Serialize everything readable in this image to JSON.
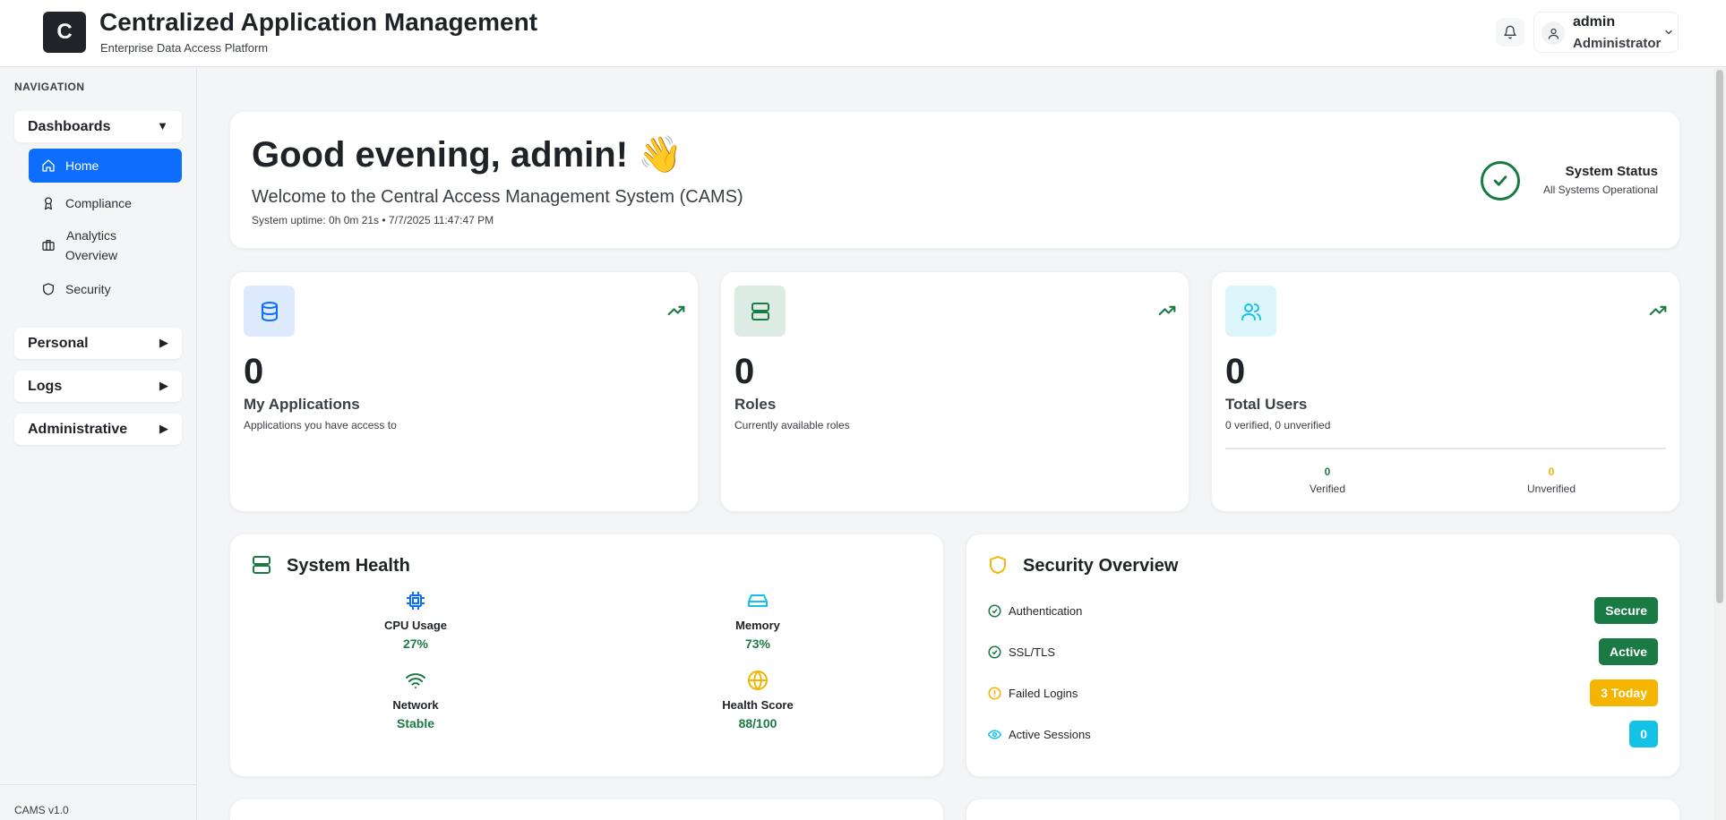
{
  "header": {
    "logo_letter": "C",
    "title": "Centralized Application Management",
    "subtitle": "Enterprise Data Access Platform",
    "user": {
      "name": "admin",
      "role": "Administrator"
    }
  },
  "sidebar": {
    "section_label": "NAVIGATION",
    "groups": [
      {
        "label": "Dashboards",
        "arrow": "▼"
      },
      {
        "label": "Personal",
        "arrow": "▶"
      },
      {
        "label": "Logs",
        "arrow": "▶"
      },
      {
        "label": "Administrative",
        "arrow": "▶"
      }
    ],
    "items": [
      {
        "label": "Home",
        "icon": "home-icon",
        "active": true
      },
      {
        "label": "Compliance",
        "icon": "award-icon"
      },
      {
        "label": "Analytics Overview",
        "icon": "briefcase-icon"
      },
      {
        "label": "Security",
        "icon": "shield-icon"
      }
    ],
    "version": "CAMS v1.0"
  },
  "welcome": {
    "greeting": "Good evening, admin! 👋",
    "message": "Welcome to the Central Access Management System (CAMS)",
    "uptime": "System uptime: 0h 0m 21s • 7/7/2025 11:47:47 PM",
    "status_title": "System Status",
    "status_text": "All Systems Operational"
  },
  "stats": [
    {
      "value": "0",
      "title": "My Applications",
      "desc": "Applications you have access to",
      "icon": "database-icon"
    },
    {
      "value": "0",
      "title": "Roles",
      "desc": "Currently available roles",
      "icon": "server-icon"
    },
    {
      "value": "0",
      "title": "Total Users",
      "desc": "0 verified, 0 unverified",
      "icon": "users-icon",
      "verified": {
        "value": "0",
        "label": "Verified"
      },
      "unverified": {
        "value": "0",
        "label": "Unverified"
      }
    }
  ],
  "system_health": {
    "title": "System Health",
    "metrics": [
      {
        "label": "CPU Usage",
        "value": "27%",
        "icon": "cpu-icon"
      },
      {
        "label": "Memory",
        "value": "73%",
        "icon": "hard-drive-icon"
      },
      {
        "label": "Network",
        "value": "Stable",
        "icon": "wifi-icon"
      },
      {
        "label": "Health Score",
        "value": "88/100",
        "icon": "globe-icon"
      }
    ]
  },
  "security_overview": {
    "title": "Security Overview",
    "rows": [
      {
        "label": "Authentication",
        "badge": "Secure",
        "color": "#1a7a43",
        "icon": "check-circle-icon"
      },
      {
        "label": "SSL/TLS",
        "badge": "Active",
        "color": "#1a7a43",
        "icon": "check-circle-icon"
      },
      {
        "label": "Failed Logins",
        "badge": "3 Today",
        "color": "#f5b400",
        "icon": "alert-circle-icon"
      },
      {
        "label": "Active Sessions",
        "badge": "0",
        "color": "#13c2e6",
        "icon": "eye-icon"
      }
    ]
  },
  "colors": {
    "primary": "#0d6efd",
    "success": "#1a7a43",
    "warning": "#f5b400",
    "info": "#13c2e6"
  }
}
